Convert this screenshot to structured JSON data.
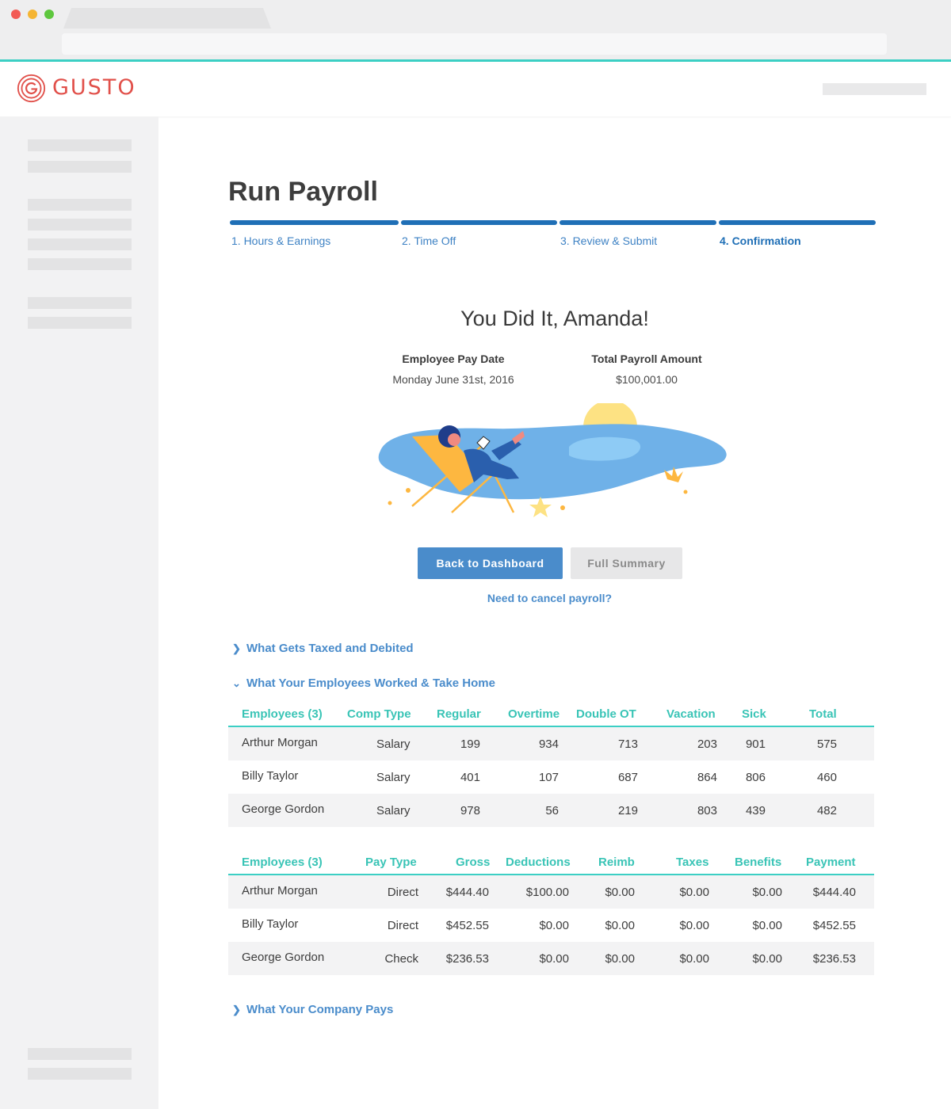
{
  "brand": {
    "name": "GUSTO",
    "color": "#e1504a",
    "accent": "#3ccfc4",
    "link": "#4a8ccb",
    "progress": "#1f6fb6"
  },
  "page": {
    "title": "Run Payroll"
  },
  "steps": [
    {
      "label": "1. Hours & Earnings",
      "active": false
    },
    {
      "label": "2. Time Off",
      "active": false
    },
    {
      "label": "3. Review & Submit",
      "active": false
    },
    {
      "label": "4. Confirmation",
      "active": true
    }
  ],
  "confirmation": {
    "heading": "You Did It, Amanda!",
    "pay_date_label": "Employee Pay Date",
    "pay_date_value": "Monday June 31st, 2016",
    "total_label": "Total Payroll Amount",
    "total_value": "$100,001.00"
  },
  "actions": {
    "primary": "Back to Dashboard",
    "secondary": "Full Summary",
    "cancel_link": "Need to cancel payroll?"
  },
  "sections": {
    "taxed": {
      "label": "What Gets Taxed and Debited",
      "expanded": false,
      "icon": "chevron-right-icon"
    },
    "worked": {
      "label": "What Your Employees Worked & Take Home",
      "expanded": true,
      "icon": "chevron-down-icon"
    },
    "company": {
      "label": "What Your Company Pays",
      "expanded": false,
      "icon": "chevron-right-icon"
    }
  },
  "hours_table": {
    "headers": [
      "Employees (3)",
      "Comp Type",
      "Regular",
      "Overtime",
      "Double OT",
      "Vacation",
      "Sick",
      "Total"
    ],
    "rows": [
      [
        "Arthur Morgan",
        "Salary",
        "199",
        "934",
        "713",
        "203",
        "901",
        "575"
      ],
      [
        "Billy Taylor",
        "Salary",
        "401",
        "107",
        "687",
        "864",
        "806",
        "460"
      ],
      [
        "George Gordon",
        "Salary",
        "978",
        "56",
        "219",
        "803",
        "439",
        "482"
      ]
    ]
  },
  "pay_table": {
    "headers": [
      "Employees (3)",
      "Pay Type",
      "Gross",
      "Deductions",
      "Reimb",
      "Taxes",
      "Benefits",
      "Payment"
    ],
    "rows": [
      [
        "Arthur Morgan",
        "Direct",
        "$444.40",
        "$100.00",
        "$0.00",
        "$0.00",
        "$0.00",
        "$444.40"
      ],
      [
        "Billy Taylor",
        "Direct",
        "$452.55",
        "$0.00",
        "$0.00",
        "$0.00",
        "$0.00",
        "$452.55"
      ],
      [
        "George Gordon",
        "Check",
        "$236.53",
        "$0.00",
        "$0.00",
        "$0.00",
        "$0.00",
        "$236.53"
      ]
    ]
  }
}
